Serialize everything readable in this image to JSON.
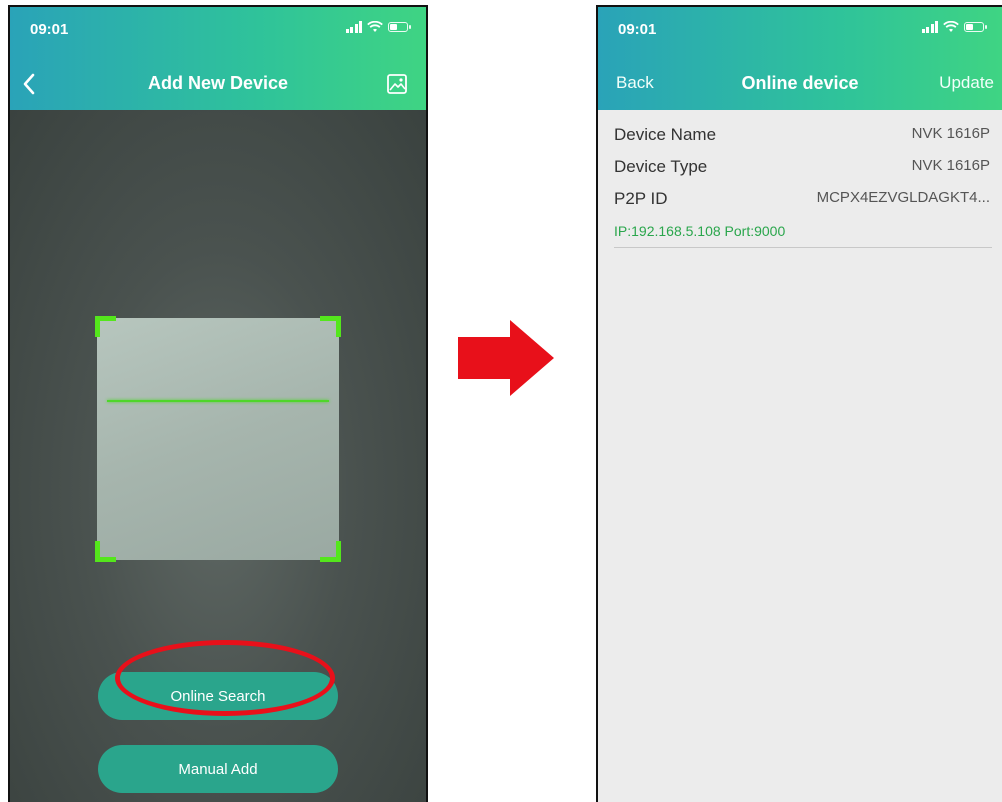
{
  "left_screen": {
    "status": {
      "time": "09:01"
    },
    "nav": {
      "title": "Add New Device",
      "back_icon": "chevron-left-icon",
      "gallery_icon": "image-gallery-icon"
    },
    "buttons": {
      "online_search": "Online Search",
      "manual_add": "Manual Add"
    }
  },
  "right_screen": {
    "status": {
      "time": "09:01"
    },
    "nav": {
      "back": "Back",
      "title": "Online device",
      "update": "Update"
    },
    "device": {
      "rows": [
        {
          "label": "Device Name",
          "value": "NVK 1616P"
        },
        {
          "label": "Device Type",
          "value": "NVK 1616P"
        },
        {
          "label": "P2P ID",
          "value": "MCPX4EZVGLDAGKT4..."
        }
      ],
      "address": "IP:192.168.5.108 Port:9000"
    }
  },
  "colors": {
    "header_start": "#2aa3b8",
    "header_end": "#3fd483",
    "button": "#2aa58c",
    "scan_corner": "#54e61c",
    "annotation": "#e8101a",
    "ip_text": "#2aa64c"
  }
}
